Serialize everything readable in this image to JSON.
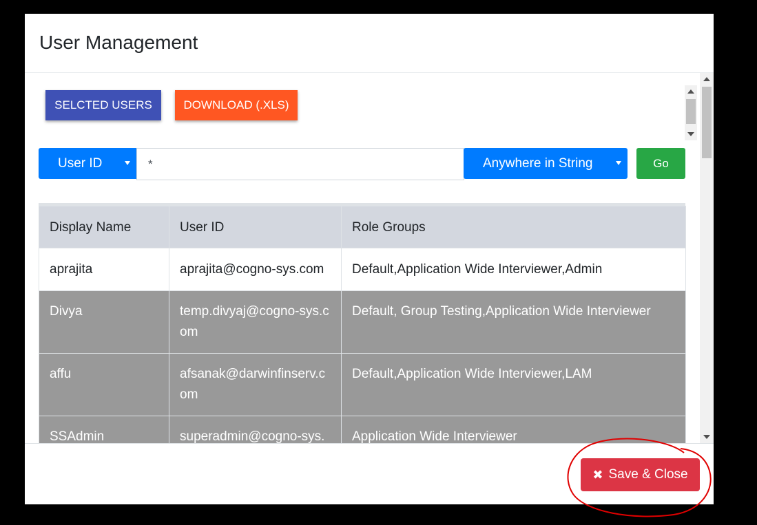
{
  "modal": {
    "title": "User Management"
  },
  "toolbar": {
    "selected_users_label": "SELCTED USERS",
    "download_label": "DOWNLOAD (.XLS)"
  },
  "search": {
    "field_select": "User ID",
    "query_value": "*",
    "match_select": "Anywhere in String",
    "go_label": "Go"
  },
  "table": {
    "headers": [
      "Display Name",
      "User ID",
      "Role Groups"
    ],
    "rows": [
      {
        "display_name": "aprajita",
        "user_id": "aprajita@cogno-sys.com",
        "role_groups": "Default,Application Wide Interviewer,Admin"
      },
      {
        "display_name": "Divya",
        "user_id": "temp.divyaj@cogno-sys.com",
        "role_groups": "Default, Group Testing,Application Wide Interviewer"
      },
      {
        "display_name": "affu",
        "user_id": "afsanak@darwinfinserv.com",
        "role_groups": "Default,Application Wide Interviewer,LAM"
      },
      {
        "display_name": "SSAdmin",
        "user_id": "superadmin@cogno-sys.com",
        "role_groups": "Application Wide Interviewer"
      }
    ]
  },
  "footer": {
    "save_close_label": "Save & Close",
    "save_icon": "close-icon"
  },
  "colors": {
    "selected_users_btn": "#3f51b5",
    "download_btn": "#ff5722",
    "select_btn": "#007bff",
    "go_btn": "#28a745",
    "save_btn": "#dc3545",
    "annotation_circle": "#e00000"
  }
}
